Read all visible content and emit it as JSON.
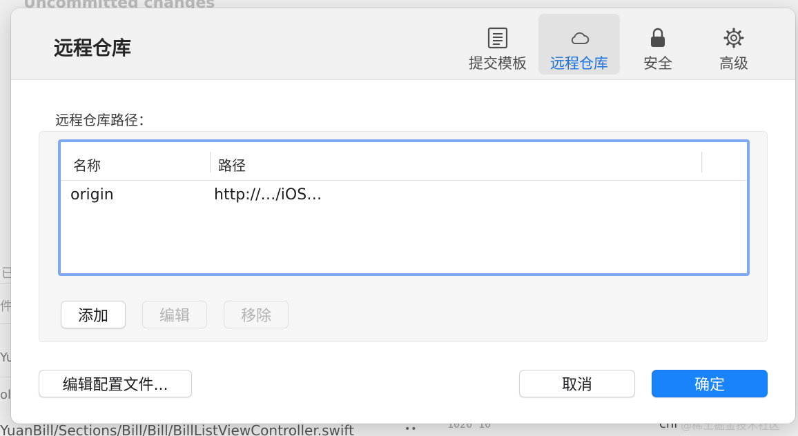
{
  "background": {
    "heading": "Uncommitted changes",
    "fragments": [
      "已",
      "件",
      "Yu",
      "ole"
    ],
    "file_path": "YuanBill/Sections/Bill/Bill/BillListViewController.swift",
    "numbers": "1020  10",
    "right_text": "chi",
    "watermark": "@稀土掘金技术社区"
  },
  "dialog": {
    "title": "远程仓库",
    "tabs": [
      {
        "label": "提交模板",
        "icon": "document-lines-icon",
        "active": false
      },
      {
        "label": "远程仓库",
        "icon": "cloud-icon",
        "active": true
      },
      {
        "label": "安全",
        "icon": "lock-icon",
        "active": false
      },
      {
        "label": "高级",
        "icon": "gear-icon",
        "active": false
      }
    ],
    "section_label": "远程仓库路径：",
    "table": {
      "columns": [
        "名称",
        "路径"
      ],
      "rows": [
        {
          "name": "origin",
          "path": "http://…/iOS…"
        }
      ]
    },
    "buttons": {
      "add": "添加",
      "edit": "编辑",
      "remove": "移除",
      "edit_config": "编辑配置文件...",
      "cancel": "取消",
      "confirm": "确定"
    }
  },
  "colors": {
    "accent": "#1883fb",
    "active_tab_text": "#1a73e0",
    "table_focus_border": "#7fa8f2"
  }
}
